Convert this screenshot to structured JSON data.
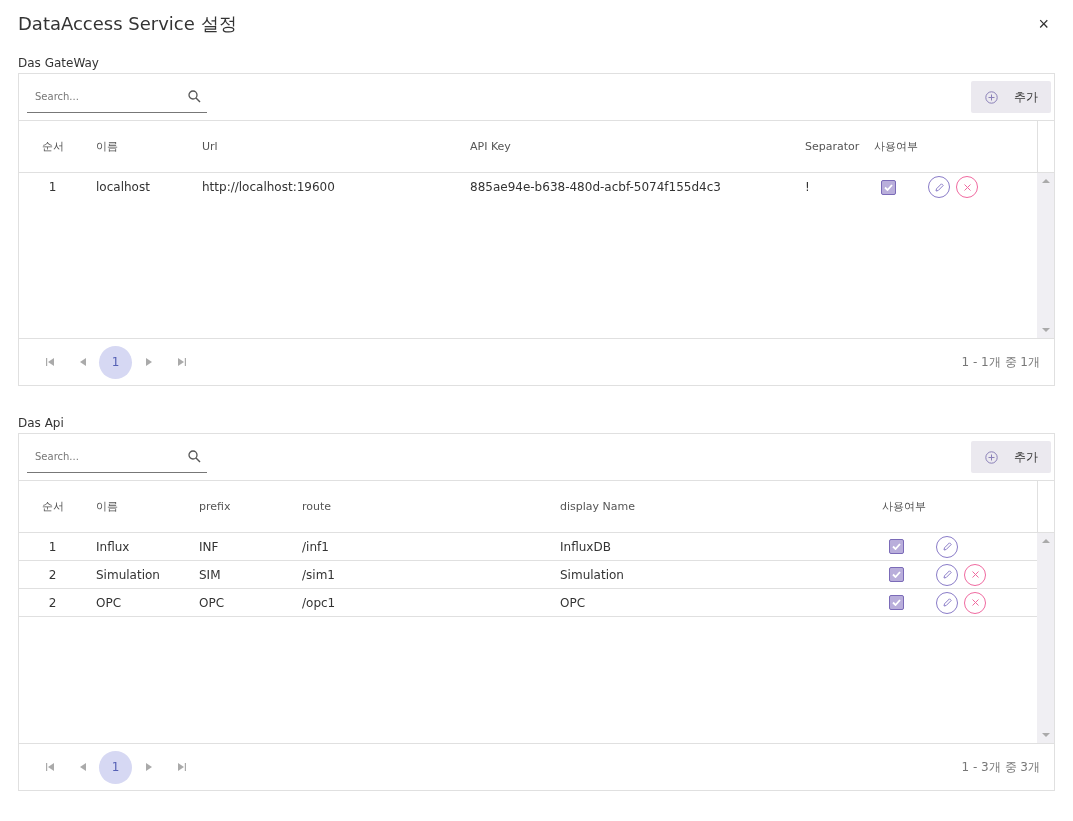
{
  "dialog": {
    "title": "DataAccess Service 설정",
    "close": "×"
  },
  "sections": [
    {
      "label": "Das GateWay",
      "search": {
        "placeholder": "Search..."
      },
      "add_button": "추가",
      "columns": [
        "순서",
        "이름",
        "Url",
        "API Key",
        "Separator",
        "사용여부"
      ],
      "rows": [
        {
          "cells": [
            "1",
            "localhost",
            "http://localhost:19600",
            "885ae94e-b638-480d-acbf-5074f155d4c3",
            "!"
          ],
          "checked": true,
          "can_delete": true
        }
      ],
      "pages": [
        {
          "label": "1",
          "selected": true
        }
      ],
      "summary": "1 - 1개 중 1개"
    },
    {
      "label": "Das Api",
      "search": {
        "placeholder": "Search..."
      },
      "add_button": "추가",
      "columns": [
        "순서",
        "이름",
        "prefix",
        "route",
        "display Name",
        "사용여부"
      ],
      "rows": [
        {
          "cells": [
            "1",
            "Influx",
            "INF",
            "/inf1",
            "InfluxDB"
          ],
          "checked": true,
          "can_delete": false
        },
        {
          "cells": [
            "2",
            "Simulation",
            "SIM",
            "/sim1",
            "Simulation"
          ],
          "checked": true,
          "can_delete": true
        },
        {
          "cells": [
            "2",
            "OPC",
            "OPC",
            "/opc1",
            "OPC"
          ],
          "checked": true,
          "can_delete": true
        }
      ],
      "pages": [
        {
          "label": "1",
          "selected": true
        }
      ],
      "summary": "1 - 3개 중 3개"
    }
  ]
}
